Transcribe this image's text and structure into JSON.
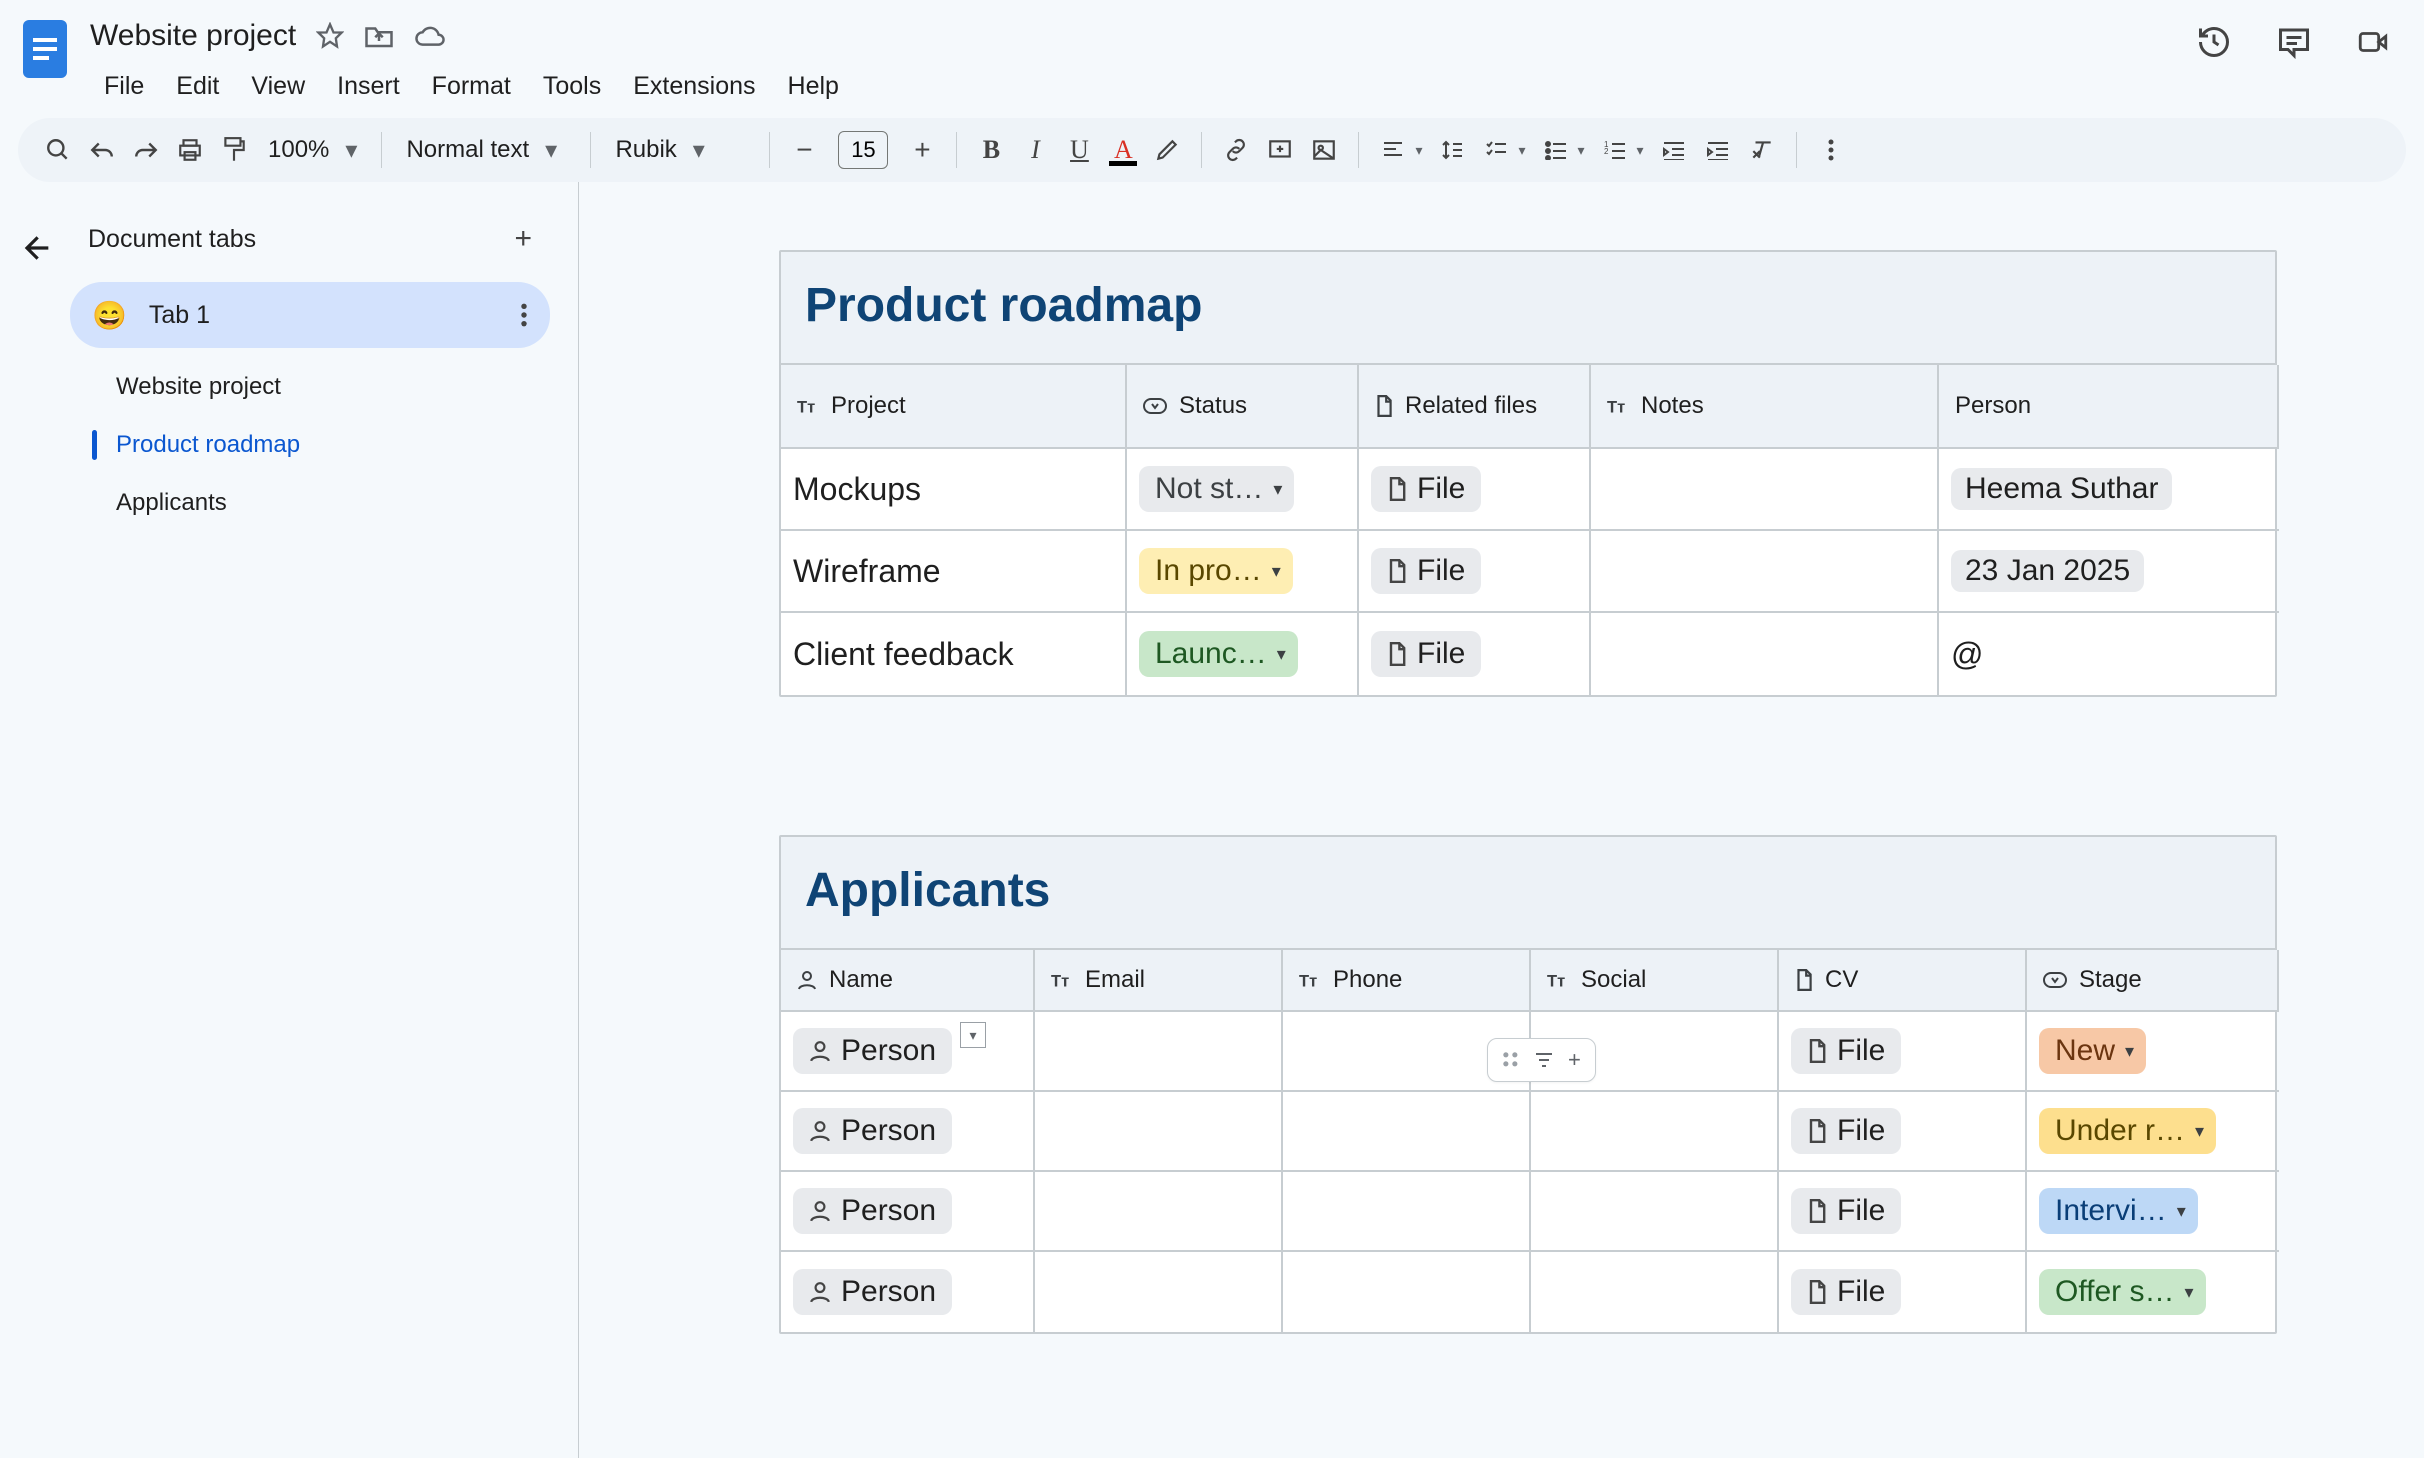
{
  "header": {
    "doc_title": "Website project",
    "menus": [
      "File",
      "Edit",
      "View",
      "Insert",
      "Format",
      "Tools",
      "Extensions",
      "Help"
    ]
  },
  "toolbar": {
    "zoom": "100%",
    "paragraph_style": "Normal text",
    "font": "Rubik",
    "font_size": "15"
  },
  "sidebar": {
    "heading": "Document tabs",
    "tab": {
      "emoji": "😄",
      "label": "Tab 1"
    },
    "outline": [
      {
        "label": "Website project",
        "active": false
      },
      {
        "label": "Product roadmap",
        "active": true
      },
      {
        "label": "Applicants",
        "active": false
      }
    ]
  },
  "roadmap": {
    "title": "Product roadmap",
    "columns": {
      "c0": "Project",
      "c1": "Status",
      "c2": "Related files",
      "c3": "Notes",
      "c4": "Person"
    },
    "rows": [
      {
        "project": "Mockups",
        "status": "Not st…",
        "status_class": "s-notstarted",
        "file": "File",
        "notes": "",
        "person": "Heema Suthar"
      },
      {
        "project": "Wireframe",
        "status": "In pro…",
        "status_class": "s-inprogress",
        "file": "File",
        "notes": "",
        "person": "23 Jan 2025"
      },
      {
        "project": "Client feedback",
        "status": "Launc…",
        "status_class": "s-launched",
        "file": "File",
        "notes": "",
        "person": "@"
      }
    ]
  },
  "applicants": {
    "title": "Applicants",
    "columns": {
      "c0": "Name",
      "c1": "Email",
      "c2": "Phone",
      "c3": "Social",
      "c4": "CV",
      "c5": "Stage"
    },
    "rows": [
      {
        "name": "Person",
        "cv": "File",
        "stage": "New",
        "stage_class": "s-new"
      },
      {
        "name": "Person",
        "cv": "File",
        "stage": "Under r…",
        "stage_class": "s-under"
      },
      {
        "name": "Person",
        "cv": "File",
        "stage": "Intervi…",
        "stage_class": "s-interview"
      },
      {
        "name": "Person",
        "cv": "File",
        "stage": "Offer s…",
        "stage_class": "s-offer"
      }
    ]
  }
}
